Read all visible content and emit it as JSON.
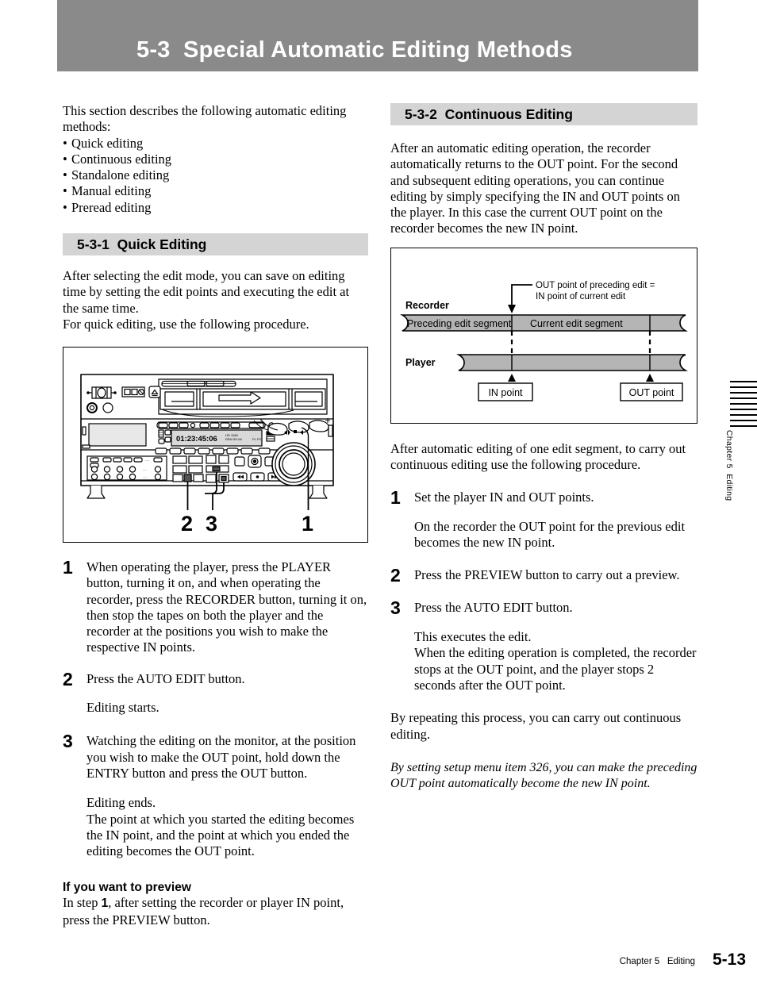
{
  "banner": {
    "title": "5-3  Special Automatic Editing Methods"
  },
  "left_column": {
    "intro": "This section describes the following automatic editing methods:",
    "bullets": [
      "Quick editing",
      "Continuous editing",
      "Standalone editing",
      "Manual editing",
      "Preread editing"
    ],
    "section_heading": "5-3-1  Quick Editing",
    "section_intro_1": "After selecting the edit mode, you can save on editing time by setting the edit points and executing the edit at the same time.",
    "section_intro_2": "For quick editing, use the following procedure.",
    "figure": {
      "timecode": "01:23:45:06",
      "callouts": [
        "2",
        "3",
        "1"
      ]
    },
    "steps": [
      {
        "num": "1",
        "text": "When operating the player, press the PLAYER button, turning it on, and when operating the recorder, press the RECORDER button, turning it on, then stop the tapes on both the player and the recorder at the positions you wish to make the respective IN points."
      },
      {
        "num": "2",
        "text": "Press the AUTO EDIT button.",
        "note": "Editing starts."
      },
      {
        "num": "3",
        "text": "Watching the editing on the monitor, at the position you wish to make the OUT point, hold down the ENTRY button and press the OUT button.",
        "note_line1": "Editing ends.",
        "note_line2": "The point at which you started the editing becomes the IN point, and the point at which you ended the editing becomes the OUT point."
      }
    ],
    "preview": {
      "heading": "If you want to preview",
      "text_before": "In step ",
      "step_ref": "1",
      "text_after": ", after setting the recorder or player IN point, press the PREVIEW button."
    }
  },
  "right_column": {
    "section_heading": "5-3-2  Continuous Editing",
    "intro": "After an automatic editing operation, the recorder automatically returns to the OUT point.  For the second and subsequent editing operations, you can continue editing by simply specifying the IN and OUT points on the player.  In this case the current OUT point on the recorder becomes the new IN point.",
    "diagram": {
      "callout_line1": "OUT point of preceding edit =",
      "callout_line2": "IN point of current edit",
      "recorder_label": "Recorder",
      "player_label": "Player",
      "segment_preceding": "Preceding edit segment",
      "segment_current": "Current edit segment",
      "in_point_label": "IN point",
      "out_point_label": "OUT point",
      "tape_fill": "#b5b5b5"
    },
    "lead_in": "After automatic editing of one edit segment, to carry out continuous editing use the following procedure.",
    "steps": [
      {
        "num": "1",
        "text": "Set the player IN and OUT points.",
        "note": "On the recorder the OUT point for the previous edit becomes the new IN point."
      },
      {
        "num": "2",
        "text": "Press the PREVIEW button to carry out a preview."
      },
      {
        "num": "3",
        "text": "Press the AUTO EDIT button.",
        "note_line1": "This executes the edit.",
        "note_line2": "When the editing operation is completed, the recorder stops at the OUT point, and the player stops 2 seconds after the OUT point."
      }
    ],
    "closing": "By repeating this process, you can carry out continuous editing.",
    "italic_note": "By setting setup menu item 326, you can make the preceding OUT point automatically become the new IN point."
  },
  "footer": {
    "chapter": "Chapter 5   Editing",
    "page": "5-13"
  },
  "thumb_tab": {
    "label": "Chapter 5  Editing"
  }
}
